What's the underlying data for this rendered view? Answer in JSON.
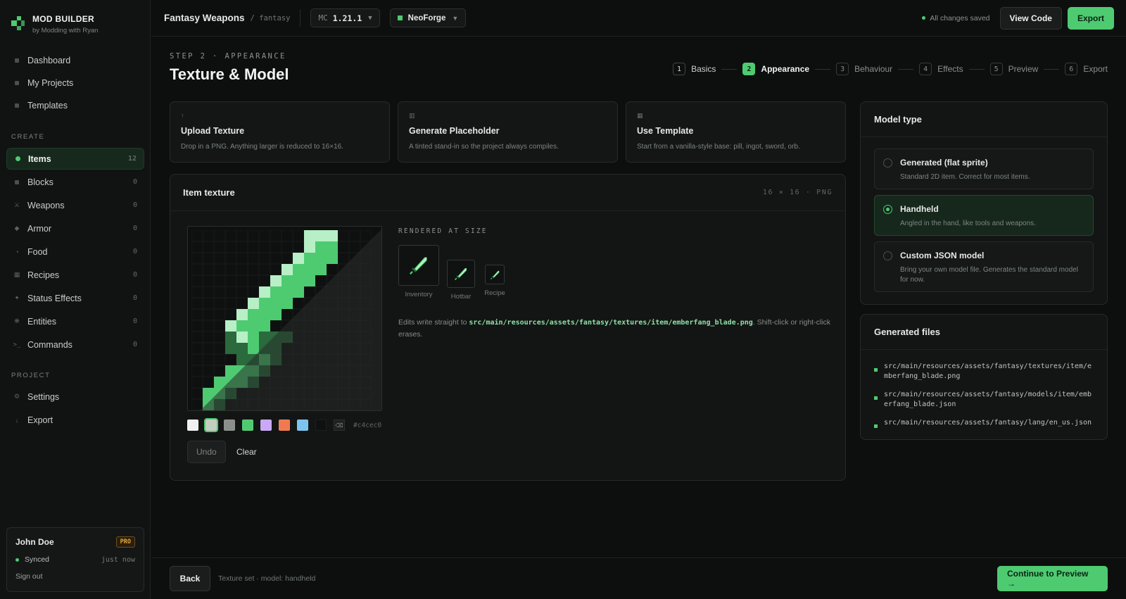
{
  "brand": {
    "title": "MOD BUILDER",
    "subtitle": "by Modding with Ryan"
  },
  "sidebar": {
    "top_items": [
      {
        "label": "Dashboard",
        "icon": "square-icon"
      },
      {
        "label": "My Projects",
        "icon": "square-icon"
      },
      {
        "label": "Templates",
        "icon": "square-icon"
      }
    ],
    "create_label": "CREATE",
    "create_items": [
      {
        "label": "Items",
        "count": "12",
        "icon": "dot-icon",
        "active": true
      },
      {
        "label": "Blocks",
        "count": "0",
        "icon": "square-icon"
      },
      {
        "label": "Weapons",
        "count": "0",
        "icon": "sword-icon"
      },
      {
        "label": "Armor",
        "count": "0",
        "icon": "diamond-icon"
      },
      {
        "label": "Food",
        "count": "0",
        "icon": "food-icon"
      },
      {
        "label": "Recipes",
        "count": "0",
        "icon": "grid-icon"
      },
      {
        "label": "Status Effects",
        "count": "0",
        "icon": "sparkle-icon"
      },
      {
        "label": "Entities",
        "count": "0",
        "icon": "entity-icon"
      },
      {
        "label": "Commands",
        "count": "0",
        "icon": "prompt-icon"
      }
    ],
    "project_label": "PROJECT",
    "project_items": [
      {
        "label": "Settings",
        "icon": "gear-icon"
      },
      {
        "label": "Export",
        "icon": "export-icon"
      }
    ],
    "user": {
      "name": "John Doe",
      "badge": "PRO",
      "sync_status": "Synced",
      "sync_time": "just now",
      "signout": "Sign out"
    }
  },
  "topbar": {
    "project_name": "Fantasy Weapons",
    "project_slug": "/ fantasy",
    "mc_label": "MC",
    "mc_version": "1.21.1",
    "loader": "NeoForge",
    "saved_status": "All changes saved",
    "view_code": "View Code",
    "export": "Export"
  },
  "header": {
    "eyebrow": "STEP 2 · APPEARANCE",
    "title": "Texture & Model",
    "steps": [
      {
        "num": "1",
        "label": "Basics",
        "state": "done"
      },
      {
        "num": "2",
        "label": "Appearance",
        "state": "active"
      },
      {
        "num": "3",
        "label": "Behaviour",
        "state": "todo"
      },
      {
        "num": "4",
        "label": "Effects",
        "state": "todo"
      },
      {
        "num": "5",
        "label": "Preview",
        "state": "todo"
      },
      {
        "num": "6",
        "label": "Export",
        "state": "todo"
      }
    ]
  },
  "source_options": [
    {
      "icon": "↑",
      "title": "Upload Texture",
      "desc": "Drop in a PNG. Anything larger is reduced to 16×16."
    },
    {
      "icon": "▥",
      "title": "Generate Placeholder",
      "desc": "A tinted stand-in so the project always compiles."
    },
    {
      "icon": "▦",
      "title": "Use Template",
      "desc": "Start from a vanilla-style base: pill, ingot, sword, orb."
    }
  ],
  "texture": {
    "title": "Item texture",
    "meta": "16 × 16 · PNG",
    "rendered_label": "RENDERED AT SIZE",
    "previews": [
      "Inventory",
      "Hotbar",
      "Recipe"
    ],
    "edits_prefix": "Edits write straight to ",
    "edits_path": "src/main/resources/assets/fantasy/textures/item/emberfang_blade.png",
    "edits_suffix": ". Shift-click or right-click erases.",
    "palette": [
      "#f1f1f1",
      "#c4cec0",
      "#8a8f8c",
      "#4ecb71",
      "#c9a8f5",
      "#ef7a4f",
      "#7cc4ef",
      "#0f1110"
    ],
    "selected_swatch": 1,
    "hex": "#c4cec0",
    "undo": "Undo",
    "clear": "Clear",
    "pixels": [
      "..........LLL...",
      "..........LMM...",
      ".........LMMM...",
      "........LMMM....",
      ".......LMMM.....",
      "......LMMM......",
      ".....LMMM.......",
      "....LMMM........",
      "...LMMM.........",
      "...DLMDDD.......",
      "...DDMDD........",
      "....DDMD........",
      "...MMMD.........",
      "..MMMD..........",
      ".MMD............",
      ".MD............."
    ],
    "pixel_colors": {
      "L": "#b7efc6",
      "M": "#4ecb71",
      "D": "#2a6a3d"
    }
  },
  "model": {
    "title": "Model type",
    "options": [
      {
        "title": "Generated (flat sprite)",
        "desc": "Standard 2D item. Correct for most items.",
        "selected": false
      },
      {
        "title": "Handheld",
        "desc": "Angled in the hand, like tools and weapons.",
        "selected": true
      },
      {
        "title": "Custom JSON model",
        "desc": "Bring your own model file. Generates the standard model for now.",
        "selected": false
      }
    ]
  },
  "generated": {
    "title": "Generated files",
    "files": [
      "src/main/resources/assets/fantasy/textures/item/emberfang_blade.png",
      "src/main/resources/assets/fantasy/models/item/emberfang_blade.json",
      "src/main/resources/assets/fantasy/lang/en_us.json"
    ]
  },
  "footer": {
    "back": "Back",
    "status": "Texture set · model: handheld",
    "continue": "Continue to Preview →"
  },
  "colors": {
    "accent": "#4ecb71",
    "background": "#0d0f0e",
    "panel": "#131514",
    "pro_badge": "#e8a73d"
  }
}
